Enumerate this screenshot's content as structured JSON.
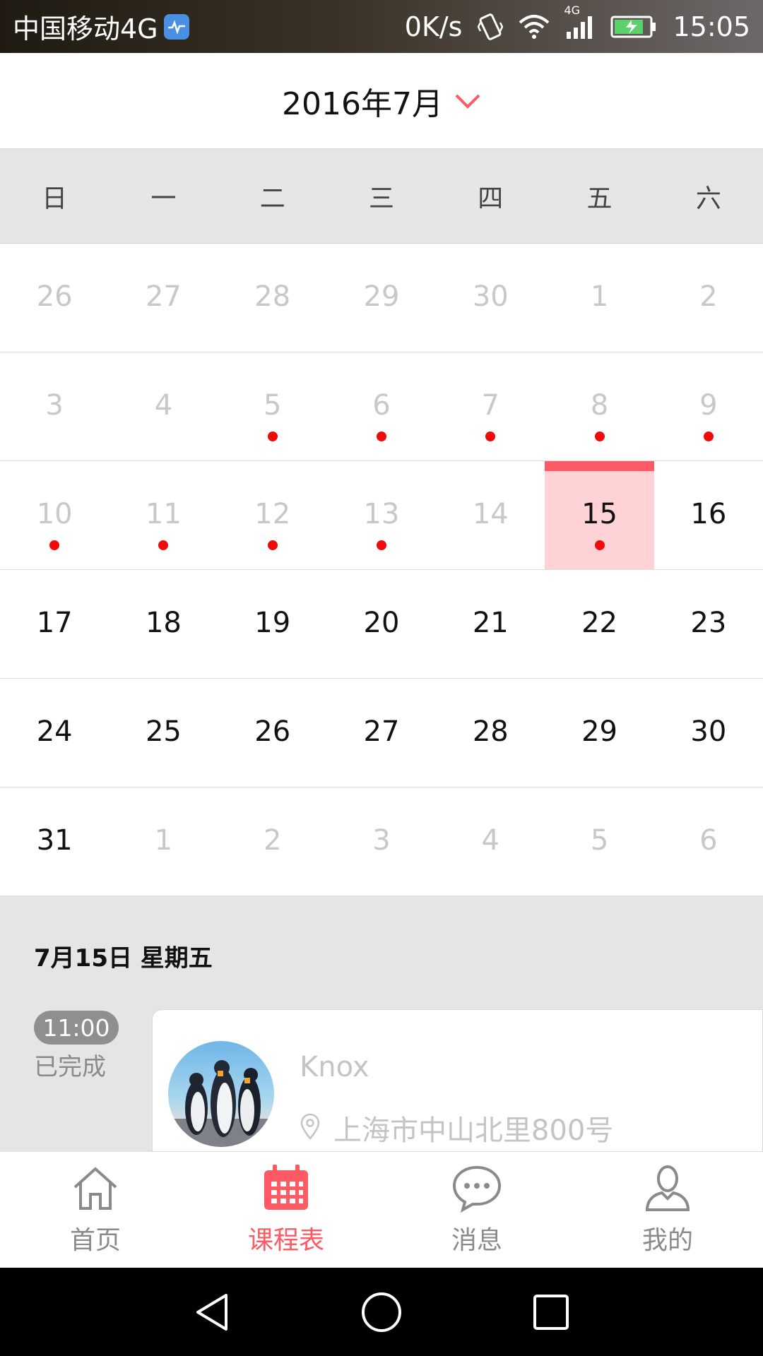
{
  "status_bar": {
    "carrier": "中国移动4G",
    "net_speed": "0K/s",
    "network_type": "4G",
    "time": "15:05",
    "icons": [
      "health-app-icon",
      "vibrate-icon",
      "wifi-icon",
      "signal-icon",
      "battery-charging-icon"
    ]
  },
  "calendar": {
    "month_title": "2016年7月",
    "weekdays": [
      "日",
      "一",
      "二",
      "三",
      "四",
      "五",
      "六"
    ],
    "weeks": [
      [
        {
          "n": "26",
          "dim": true,
          "dot": false
        },
        {
          "n": "27",
          "dim": true,
          "dot": false
        },
        {
          "n": "28",
          "dim": true,
          "dot": false
        },
        {
          "n": "29",
          "dim": true,
          "dot": false
        },
        {
          "n": "30",
          "dim": true,
          "dot": false
        },
        {
          "n": "1",
          "dim": true,
          "dot": false
        },
        {
          "n": "2",
          "dim": true,
          "dot": false
        }
      ],
      [
        {
          "n": "3",
          "dim": true,
          "dot": false
        },
        {
          "n": "4",
          "dim": true,
          "dot": false
        },
        {
          "n": "5",
          "dim": true,
          "dot": true
        },
        {
          "n": "6",
          "dim": true,
          "dot": true
        },
        {
          "n": "7",
          "dim": true,
          "dot": true
        },
        {
          "n": "8",
          "dim": true,
          "dot": true
        },
        {
          "n": "9",
          "dim": true,
          "dot": true
        }
      ],
      [
        {
          "n": "10",
          "dim": true,
          "dot": true
        },
        {
          "n": "11",
          "dim": true,
          "dot": true
        },
        {
          "n": "12",
          "dim": true,
          "dot": true
        },
        {
          "n": "13",
          "dim": true,
          "dot": true
        },
        {
          "n": "14",
          "dim": true,
          "dot": false
        },
        {
          "n": "15",
          "dim": false,
          "dot": true,
          "selected": true
        },
        {
          "n": "16",
          "dim": false,
          "dot": false
        }
      ],
      [
        {
          "n": "17",
          "dim": false,
          "dot": false
        },
        {
          "n": "18",
          "dim": false,
          "dot": false
        },
        {
          "n": "19",
          "dim": false,
          "dot": false
        },
        {
          "n": "20",
          "dim": false,
          "dot": false
        },
        {
          "n": "21",
          "dim": false,
          "dot": false
        },
        {
          "n": "22",
          "dim": false,
          "dot": false
        },
        {
          "n": "23",
          "dim": false,
          "dot": false
        }
      ],
      [
        {
          "n": "24",
          "dim": false,
          "dot": false
        },
        {
          "n": "25",
          "dim": false,
          "dot": false
        },
        {
          "n": "26",
          "dim": false,
          "dot": false
        },
        {
          "n": "27",
          "dim": false,
          "dot": false
        },
        {
          "n": "28",
          "dim": false,
          "dot": false
        },
        {
          "n": "29",
          "dim": false,
          "dot": false
        },
        {
          "n": "30",
          "dim": false,
          "dot": false
        }
      ],
      [
        {
          "n": "31",
          "dim": false,
          "dot": false
        },
        {
          "n": "1",
          "dim": true,
          "dot": false
        },
        {
          "n": "2",
          "dim": true,
          "dot": false
        },
        {
          "n": "3",
          "dim": true,
          "dot": false
        },
        {
          "n": "4",
          "dim": true,
          "dot": false
        },
        {
          "n": "5",
          "dim": true,
          "dot": false
        },
        {
          "n": "6",
          "dim": true,
          "dot": false
        }
      ]
    ]
  },
  "schedule": {
    "date_label": "7月15日 星期五",
    "lesson": {
      "time": "11:00",
      "status": "已完成",
      "teacher": "Knox",
      "address": "上海市中山北里800号"
    }
  },
  "tabbar": {
    "tabs": [
      {
        "label": "首页",
        "icon": "home-icon",
        "active": false
      },
      {
        "label": "课程表",
        "icon": "calendar-icon",
        "active": true
      },
      {
        "label": "消息",
        "icon": "message-icon",
        "active": false
      },
      {
        "label": "我的",
        "icon": "profile-icon",
        "active": false
      }
    ]
  },
  "colors": {
    "accent": "#ff5a63",
    "selected_bg": "#ffd3d6",
    "event_dot": "#f20a0a",
    "dim_text": "#c8c8c8",
    "section_bg": "#e5e5e5"
  }
}
